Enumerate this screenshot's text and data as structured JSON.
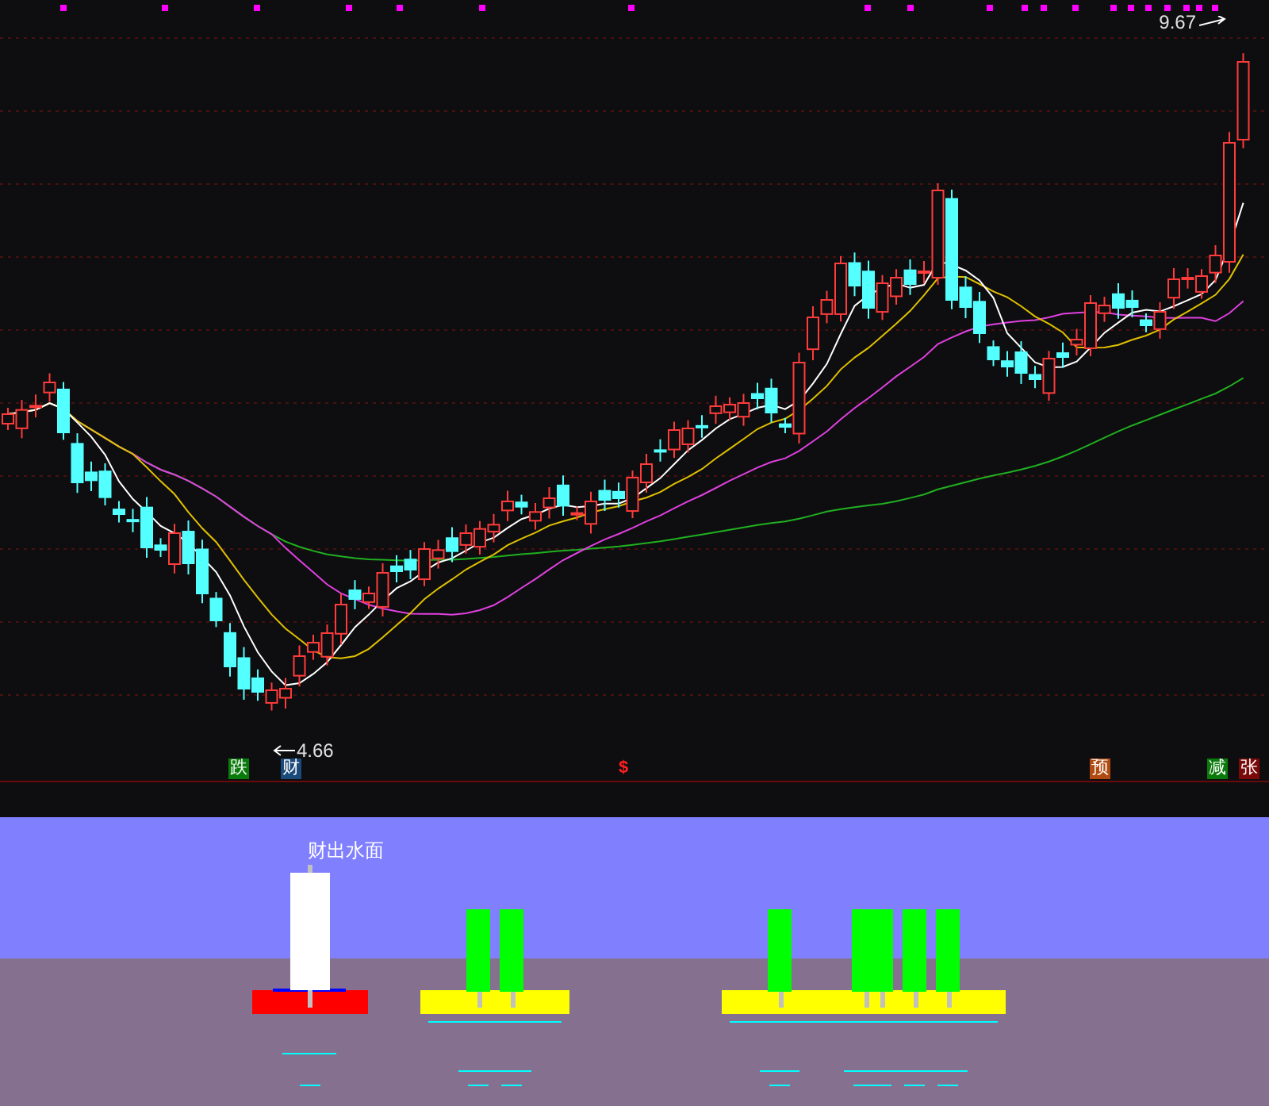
{
  "price_chart": {
    "high_label": "9.67",
    "low_label": "4.66",
    "signals": [
      {
        "label": "跌",
        "kind": "box",
        "color": "#0a7a0a"
      },
      {
        "label": "财",
        "kind": "box",
        "color": "#1a4a7a"
      },
      {
        "label": "$",
        "kind": "plain",
        "color": "#ff2020"
      },
      {
        "label": "预",
        "kind": "box",
        "color": "#b04a10"
      },
      {
        "label": "减",
        "kind": "box",
        "color": "#0a7a0a"
      },
      {
        "label": "张",
        "kind": "box",
        "color": "#7a0a0a"
      }
    ]
  },
  "indicator_panel": {
    "caption": "财出水面"
  }
}
